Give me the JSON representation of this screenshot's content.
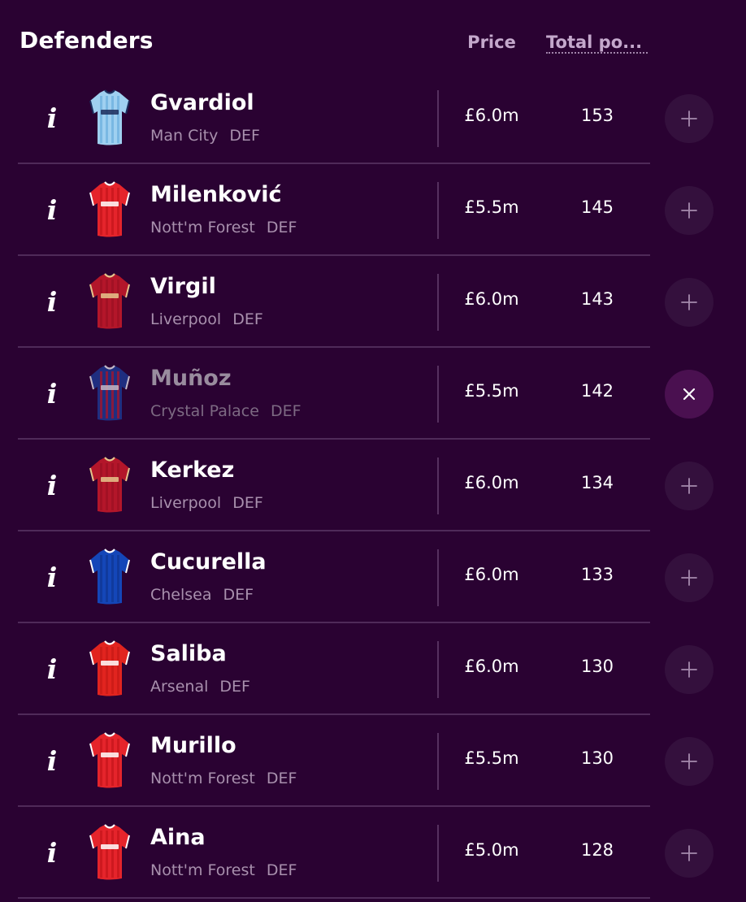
{
  "header": {
    "title": "Defenders",
    "price_label": "Price",
    "total_points_label": "Total po..."
  },
  "colors": {
    "background": "#2a0232",
    "divider": "#4f2a59",
    "button_bg": "#34103d",
    "muted_text": "#a890ad"
  },
  "icons": {
    "info": "info-icon",
    "add": "plus-icon",
    "remove": "close-icon"
  },
  "players": [
    {
      "name": "Gvardiol",
      "team": "Man City",
      "position": "DEF",
      "price": "£6.0m",
      "total_points": "153",
      "action": "add",
      "selected": false,
      "kit": {
        "base": "#9fd0f0",
        "stripe": "#6fb2e0",
        "trim": "#1c2c5b",
        "sponsor": "ETIHAD"
      }
    },
    {
      "name": "Milenković",
      "team": "Nott'm Forest",
      "position": "DEF",
      "price": "£5.5m",
      "total_points": "145",
      "action": "add",
      "selected": false,
      "kit": {
        "base": "#e5242b",
        "stripe": "#c8161d",
        "trim": "#ffffff",
        "sponsor": "Bally's"
      }
    },
    {
      "name": "Virgil",
      "team": "Liverpool",
      "position": "DEF",
      "price": "£6.0m",
      "total_points": "143",
      "action": "add",
      "selected": false,
      "kit": {
        "base": "#b3162a",
        "stripe": "#9e1023",
        "trim": "#e6c58c",
        "sponsor": "SC"
      }
    },
    {
      "name": "Muñoz",
      "team": "Crystal Palace",
      "position": "DEF",
      "price": "£5.5m",
      "total_points": "142",
      "action": "remove",
      "selected": true,
      "kit": {
        "base": "#1b3f9e",
        "stripe": "#d11e2c",
        "trim": "#ffffff",
        "sponsor": "NETBET"
      }
    },
    {
      "name": "Kerkez",
      "team": "Liverpool",
      "position": "DEF",
      "price": "£6.0m",
      "total_points": "134",
      "action": "add",
      "selected": false,
      "kit": {
        "base": "#b3162a",
        "stripe": "#9e1023",
        "trim": "#e6c58c",
        "sponsor": "SC"
      }
    },
    {
      "name": "Cucurella",
      "team": "Chelsea",
      "position": "DEF",
      "price": "£6.0m",
      "total_points": "133",
      "action": "add",
      "selected": false,
      "kit": {
        "base": "#1446b8",
        "stripe": "#0f3796",
        "trim": "#ffffff",
        "sponsor": ""
      }
    },
    {
      "name": "Saliba",
      "team": "Arsenal",
      "position": "DEF",
      "price": "£6.0m",
      "total_points": "130",
      "action": "add",
      "selected": false,
      "kit": {
        "base": "#e1241f",
        "stripe": "#c91a16",
        "trim": "#ffffff",
        "sponsor": "Emirates"
      }
    },
    {
      "name": "Murillo",
      "team": "Nott'm Forest",
      "position": "DEF",
      "price": "£5.5m",
      "total_points": "130",
      "action": "add",
      "selected": false,
      "kit": {
        "base": "#e5242b",
        "stripe": "#c8161d",
        "trim": "#ffffff",
        "sponsor": "Bally's"
      }
    },
    {
      "name": "Aina",
      "team": "Nott'm Forest",
      "position": "DEF",
      "price": "£5.0m",
      "total_points": "128",
      "action": "add",
      "selected": false,
      "kit": {
        "base": "#e5242b",
        "stripe": "#c8161d",
        "trim": "#ffffff",
        "sponsor": "Bally's"
      }
    }
  ]
}
